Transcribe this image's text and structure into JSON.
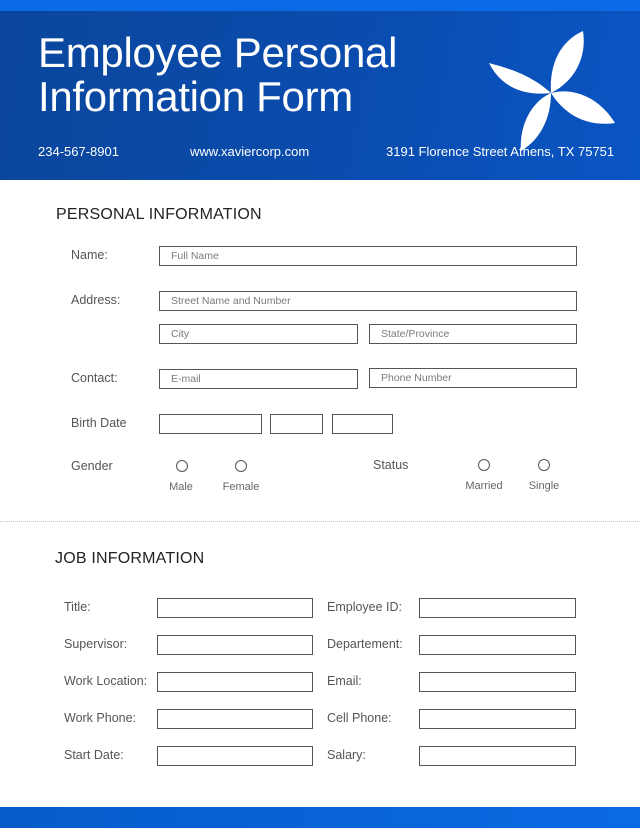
{
  "colors": {
    "top_stripe": "#0b6be6",
    "header_dark": "#0a469c",
    "header_light": "#0a55c4",
    "field_border": "#555555"
  },
  "header": {
    "title_line1": "Employee Personal",
    "title_line2": "Information Form",
    "phone": "234-567-8901",
    "website": "www.xaviercorp.com",
    "address": "3191 Florence Street Athens, TX 75751",
    "logo_icon": "four-petal-flower-icon"
  },
  "personal": {
    "section_title": "PERSONAL INFORMATION",
    "name_label": "Name:",
    "name_placeholder": "Full Name",
    "address_label": "Address:",
    "street_placeholder": "Street Name and Number",
    "city_placeholder": "City",
    "state_placeholder": "State/Province",
    "contact_label": "Contact:",
    "email_placeholder": "E-mail",
    "phone_placeholder": "Phone Number",
    "birth_label": "Birth Date",
    "gender_label": "Gender",
    "gender_options": [
      "Male",
      "Female"
    ],
    "status_label": "Status",
    "status_options": [
      "Married",
      "Single"
    ]
  },
  "job": {
    "section_title": "JOB INFORMATION",
    "left_labels": [
      "Title:",
      "Supervisor:",
      "Work Location:",
      "Work Phone:",
      "Start Date:"
    ],
    "right_labels": [
      "Employee ID:",
      "Departement:",
      "Email:",
      "Cell Phone:",
      "Salary:"
    ]
  }
}
